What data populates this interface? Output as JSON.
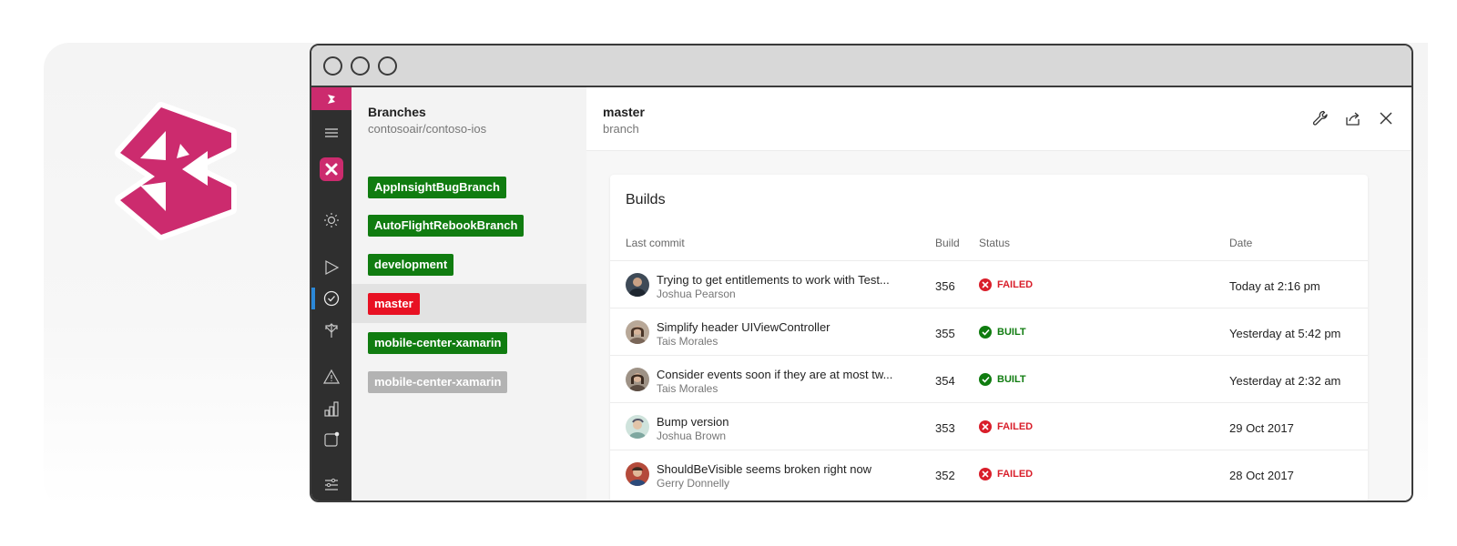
{
  "colors": {
    "brand": "#cc2b6e",
    "rail": "#2f2f2f",
    "tag_green": "#107c10",
    "tag_red": "#e81123",
    "tag_gray": "#b3b3b3",
    "failed": "#d91e2a",
    "built": "#107c10"
  },
  "rail": {
    "items": [
      {
        "name": "app-logo-icon"
      },
      {
        "name": "hamburger-menu-icon"
      },
      {
        "name": "app-avatar-icon"
      },
      {
        "name": "sun-icon"
      },
      {
        "name": "play-icon"
      },
      {
        "name": "check-circle-icon",
        "active": true
      },
      {
        "name": "distribute-icon"
      },
      {
        "name": "warning-icon"
      },
      {
        "name": "analytics-icon"
      },
      {
        "name": "notification-icon"
      },
      {
        "name": "settings-sliders-icon"
      }
    ]
  },
  "branches": {
    "title": "Branches",
    "subtitle": "contosoair/contoso-ios",
    "items": [
      {
        "label": "AppInsightBugBranch",
        "color": "green"
      },
      {
        "label": "AutoFlightRebookBranch",
        "color": "green"
      },
      {
        "label": "development",
        "color": "green"
      },
      {
        "label": "master",
        "color": "red",
        "selected": true
      },
      {
        "label": "mobile-center-xamarin",
        "color": "green"
      },
      {
        "label": "mobile-center-xamarin",
        "color": "gray"
      }
    ]
  },
  "detail": {
    "title": "master",
    "subtitle": "branch",
    "actions": [
      "wrench-icon",
      "share-icon",
      "close-icon"
    ]
  },
  "builds": {
    "title": "Builds",
    "columns": {
      "commit": "Last commit",
      "build": "Build",
      "status": "Status",
      "date": "Date"
    },
    "rows": [
      {
        "message": "Trying to get entitlements to work with Test...",
        "author": "Joshua Pearson",
        "build": "356",
        "status": "FAILED",
        "date": "Today at 2:16 pm"
      },
      {
        "message": "Simplify header UIViewController",
        "author": "Tais Morales",
        "build": "355",
        "status": "BUILT",
        "date": "Yesterday at 5:42 pm"
      },
      {
        "message": "Consider events soon if they are at most tw...",
        "author": "Tais Morales",
        "build": "354",
        "status": "BUILT",
        "date": "Yesterday at 2:32 am"
      },
      {
        "message": "Bump version",
        "author": "Joshua Brown",
        "build": "353",
        "status": "FAILED",
        "date": "29 Oct 2017"
      },
      {
        "message": "ShouldBeVisible seems broken right now",
        "author": "Gerry Donnelly",
        "build": "352",
        "status": "FAILED",
        "date": "28 Oct 2017"
      }
    ]
  }
}
